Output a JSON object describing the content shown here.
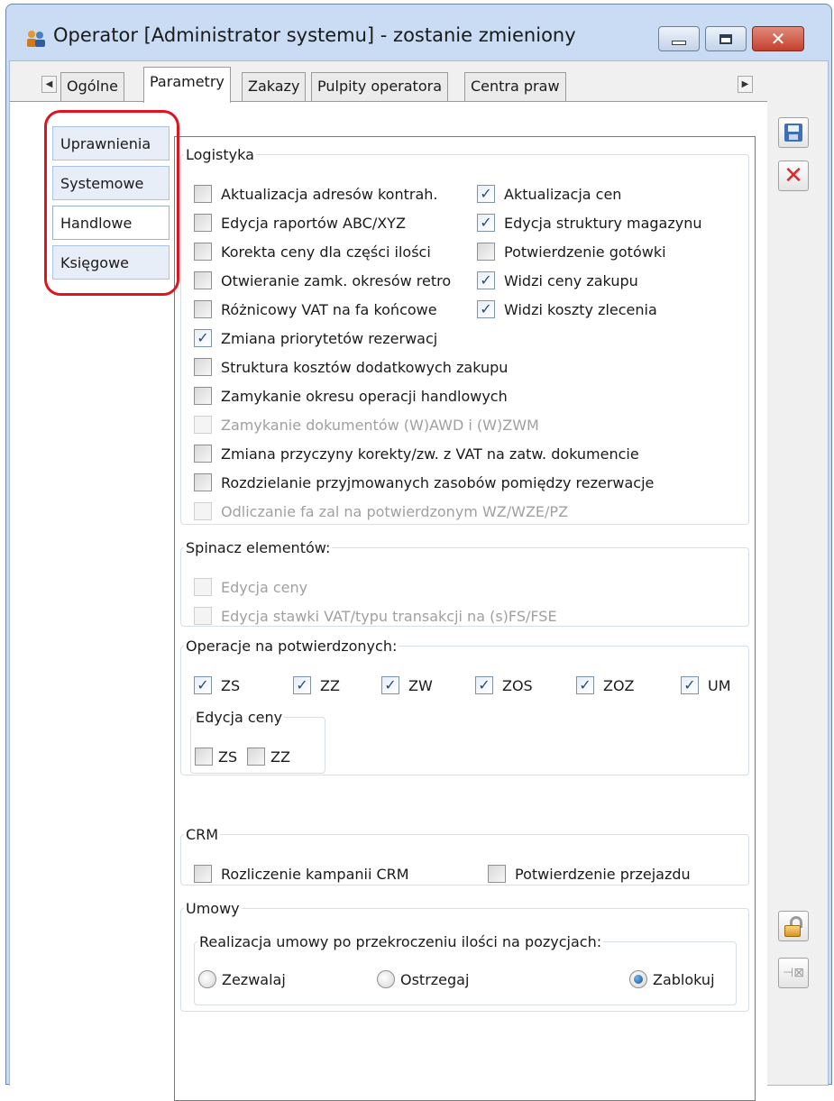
{
  "window": {
    "title": "Operator [Administrator systemu] - zostanie zmieniony",
    "controls": [
      "minimize",
      "maximize",
      "close"
    ],
    "close_glyph": "✕"
  },
  "tabs": {
    "items": [
      "Ogólne",
      "Parametry",
      "Zakazy",
      "Pulpity operatora",
      "Centra praw"
    ],
    "active": "Parametry",
    "scroll_left": "◀",
    "scroll_right": "▶"
  },
  "side_tabs": {
    "items": [
      "Uprawnienia",
      "Systemowe",
      "Handlowe",
      "Księgowe"
    ],
    "active": "Handlowe",
    "highlight_color": "#e0141e"
  },
  "logistyka": {
    "legend": "Logistyka",
    "items": [
      {
        "label": "Aktualizacja adresów kontrah.",
        "checked": false
      },
      {
        "label": "Aktualizacja cen",
        "checked": true
      },
      {
        "label": "Edycja raportów ABC/XYZ",
        "checked": false
      },
      {
        "label": "Edycja struktury magazynu",
        "checked": true
      },
      {
        "label": "Korekta ceny dla części ilości",
        "checked": false
      },
      {
        "label": "Potwierdzenie gotówki",
        "checked": false
      },
      {
        "label": "Otwieranie zamk. okresów retro",
        "checked": false
      },
      {
        "label": "Widzi ceny zakupu",
        "checked": true
      },
      {
        "label": "Różnicowy VAT na fa końcowe",
        "checked": false
      },
      {
        "label": "Widzi koszty zlecenia",
        "checked": true
      },
      {
        "label": "Zmiana priorytetów rezerwacj",
        "checked": true
      },
      {
        "label": "Struktura kosztów dodatkowych zakupu",
        "checked": false
      },
      {
        "label": "Zamykanie okresu operacji handlowych",
        "checked": false
      },
      {
        "label": "Zamykanie dokumentów (W)AWD i (W)ZWM",
        "checked": false,
        "disabled": true
      },
      {
        "label": "Zmiana przyczyny korekty/zw. z VAT na zatw. dokumencie",
        "checked": false
      },
      {
        "label": "Rozdzielanie przyjmowanych zasobów pomiędzy rezerwacje",
        "checked": false
      },
      {
        "label": "Odliczanie fa zal na potwierdzonym WZ/WZE/PZ",
        "checked": false,
        "disabled": true
      }
    ]
  },
  "spinacz": {
    "legend": "Spinacz elementów:",
    "items": [
      {
        "label": "Edycja ceny",
        "checked": false,
        "disabled": true
      },
      {
        "label": "Edycja stawki VAT/typu transakcji na (s)FS/FSE",
        "checked": false,
        "disabled": true
      }
    ]
  },
  "operacje": {
    "legend": "Operacje na potwierdzonych:",
    "items": [
      {
        "label": "ZS",
        "checked": true
      },
      {
        "label": "ZZ",
        "checked": true
      },
      {
        "label": "ZW",
        "checked": true
      },
      {
        "label": "ZOS",
        "checked": true
      },
      {
        "label": "ZOZ",
        "checked": true
      },
      {
        "label": "UM",
        "checked": true
      }
    ],
    "edycja_ceny": {
      "legend": "Edycja ceny",
      "items": [
        {
          "label": "ZS",
          "checked": false
        },
        {
          "label": "ZZ",
          "checked": false
        }
      ]
    }
  },
  "crm": {
    "legend": "CRM",
    "items": [
      {
        "label": "Rozliczenie kampanii CRM",
        "checked": false
      },
      {
        "label": "Potwierdzenie przejazdu",
        "checked": false
      }
    ]
  },
  "umowy": {
    "legend": "Umowy",
    "group_legend": "Realizacja umowy po przekroczeniu ilości na pozycjach:",
    "options": [
      "Zezwalaj",
      "Ostrzegaj",
      "Zablokuj"
    ],
    "selected": "Zablokuj"
  },
  "toolbar": {
    "save": "save-icon",
    "cancel": "cancel-icon",
    "lock": "lock-icon",
    "pin": "pin-icon",
    "check_glyph": "✓"
  }
}
